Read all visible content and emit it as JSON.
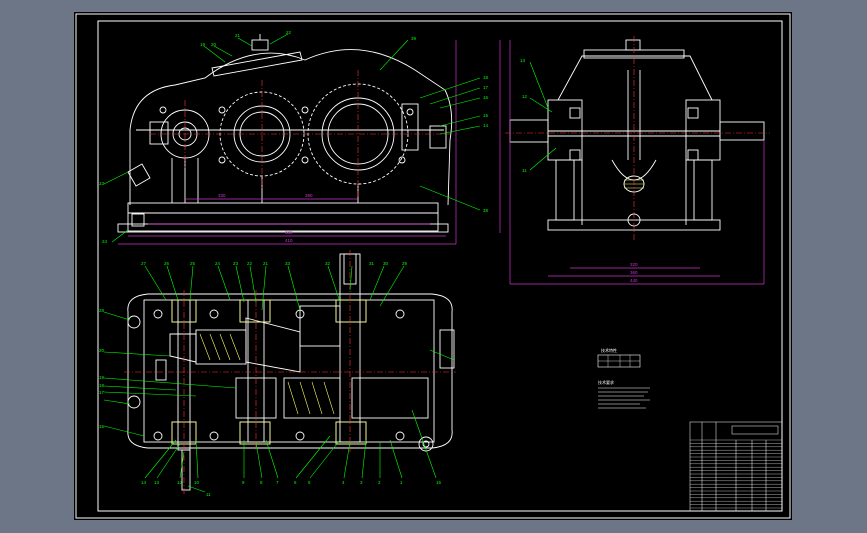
{
  "colors": {
    "viewport_bg": "#6d7686",
    "sheet_bg": "#000000",
    "geometry": "#ffffff",
    "leaders": "#00ff00",
    "dimensions": "#cc33cc",
    "centerlines": "#ff3333",
    "hatch": "#ffff66"
  },
  "balloons": {
    "front_view": [
      "19",
      "20",
      "21",
      "22",
      "39",
      "18",
      "17",
      "16",
      "15",
      "14",
      "38",
      "23",
      "24"
    ],
    "side_view": [
      "13",
      "12",
      "11"
    ],
    "top_view": [
      "27",
      "26",
      "25",
      "24",
      "23",
      "22",
      "21",
      "33",
      "32",
      "31",
      "30",
      "29",
      "28",
      "20",
      "19",
      "18",
      "17",
      "16",
      "1",
      "2",
      "3",
      "4",
      "5",
      "6",
      "7",
      "8",
      "9",
      "10",
      "11",
      "12",
      "13",
      "14",
      "15"
    ]
  },
  "dimensions": {
    "front_view": [
      "410",
      "380",
      "330",
      "380"
    ],
    "side_view": [
      "440",
      "320",
      "360"
    ]
  },
  "notes": {
    "spec_title": "技术特性",
    "tech_title": "技术要求"
  }
}
